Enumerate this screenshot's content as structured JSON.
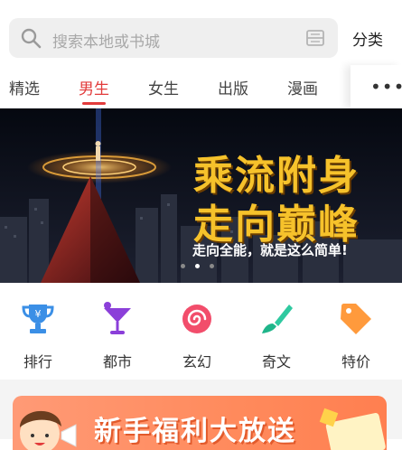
{
  "search": {
    "placeholder": "搜索本地或书城",
    "category_label": "分类"
  },
  "tabs": [
    {
      "label": "精选",
      "active": false
    },
    {
      "label": "男生",
      "active": true
    },
    {
      "label": "女生",
      "active": false
    },
    {
      "label": "出版",
      "active": false
    },
    {
      "label": "漫画",
      "active": false
    }
  ],
  "tabs_more": "•••",
  "banner": {
    "title_line1": "乘流附身",
    "title_line2": "走向巅峰",
    "subtitle": "走向全能，就是这么简单!",
    "slide_count": 3,
    "active_slide": 2
  },
  "categories": [
    {
      "label": "排行",
      "icon": "trophy-icon",
      "color": "#3b8fe6"
    },
    {
      "label": "都市",
      "icon": "cocktail-icon",
      "color": "#8b3fd9"
    },
    {
      "label": "玄幻",
      "icon": "swirl-icon",
      "color": "#f24d6b"
    },
    {
      "label": "奇文",
      "icon": "brush-icon",
      "color": "#2fc9a0"
    },
    {
      "label": "特价",
      "icon": "price-tag-icon",
      "color": "#ff9a3c"
    }
  ],
  "promo": {
    "text": "新手福利大放送"
  },
  "colors": {
    "accent": "#e23b3b",
    "banner_gold": "#f6c22b"
  }
}
